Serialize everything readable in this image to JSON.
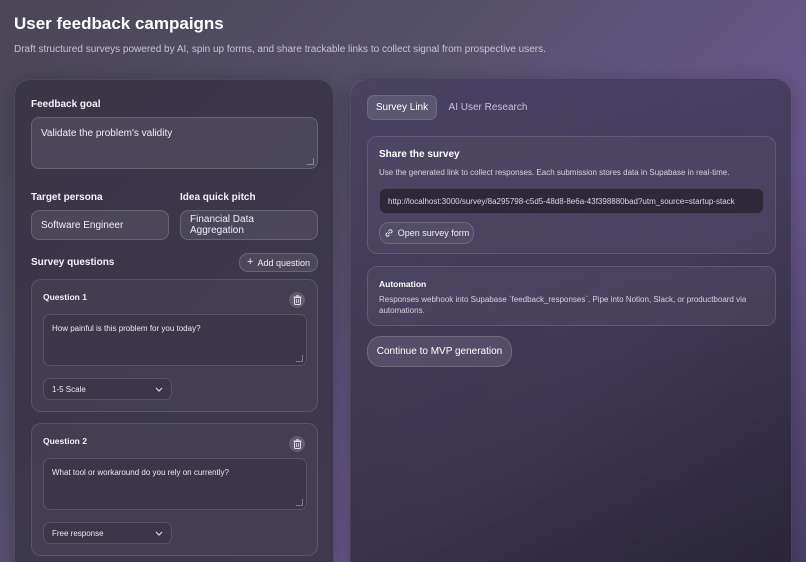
{
  "header": {
    "title": "User feedback campaigns",
    "subtitle": "Draft structured surveys powered by AI, spin up forms, and share trackable links to collect signal from prospective users."
  },
  "form": {
    "goal_label": "Feedback goal",
    "goal_value": "Validate the problem's validity",
    "persona_label": "Target persona",
    "persona_value": "Software Engineer",
    "pitch_label": "Idea quick pitch",
    "pitch_value": "Financial Data Aggregation",
    "questions_label": "Survey questions",
    "add_question_label": "Add question"
  },
  "questions": [
    {
      "label": "Question 1",
      "text": "How painful is this problem for you today?",
      "type": "1-5 Scale"
    },
    {
      "label": "Question 2",
      "text": "What tool or workaround do you rely on currently?",
      "type": "Free response"
    }
  ],
  "tabs": [
    {
      "label": "Survey Link",
      "active": true
    },
    {
      "label": "AI User Research",
      "active": false
    }
  ],
  "share": {
    "title": "Share the survey",
    "description": "Use the generated link to collect responses. Each submission stores data in Supabase in real-time.",
    "url": "http://localhost:3000/survey/8a295798-c5d5-48d8-8e6a-43f398880bad?utm_source=startup-stack",
    "open_label": "Open survey form"
  },
  "automation": {
    "title": "Automation",
    "description": "Responses webhook into Supabase `feedback_responses`. Pipe into Notion, Slack, or productboard via automations."
  },
  "cta_label": "Continue to MVP generation"
}
